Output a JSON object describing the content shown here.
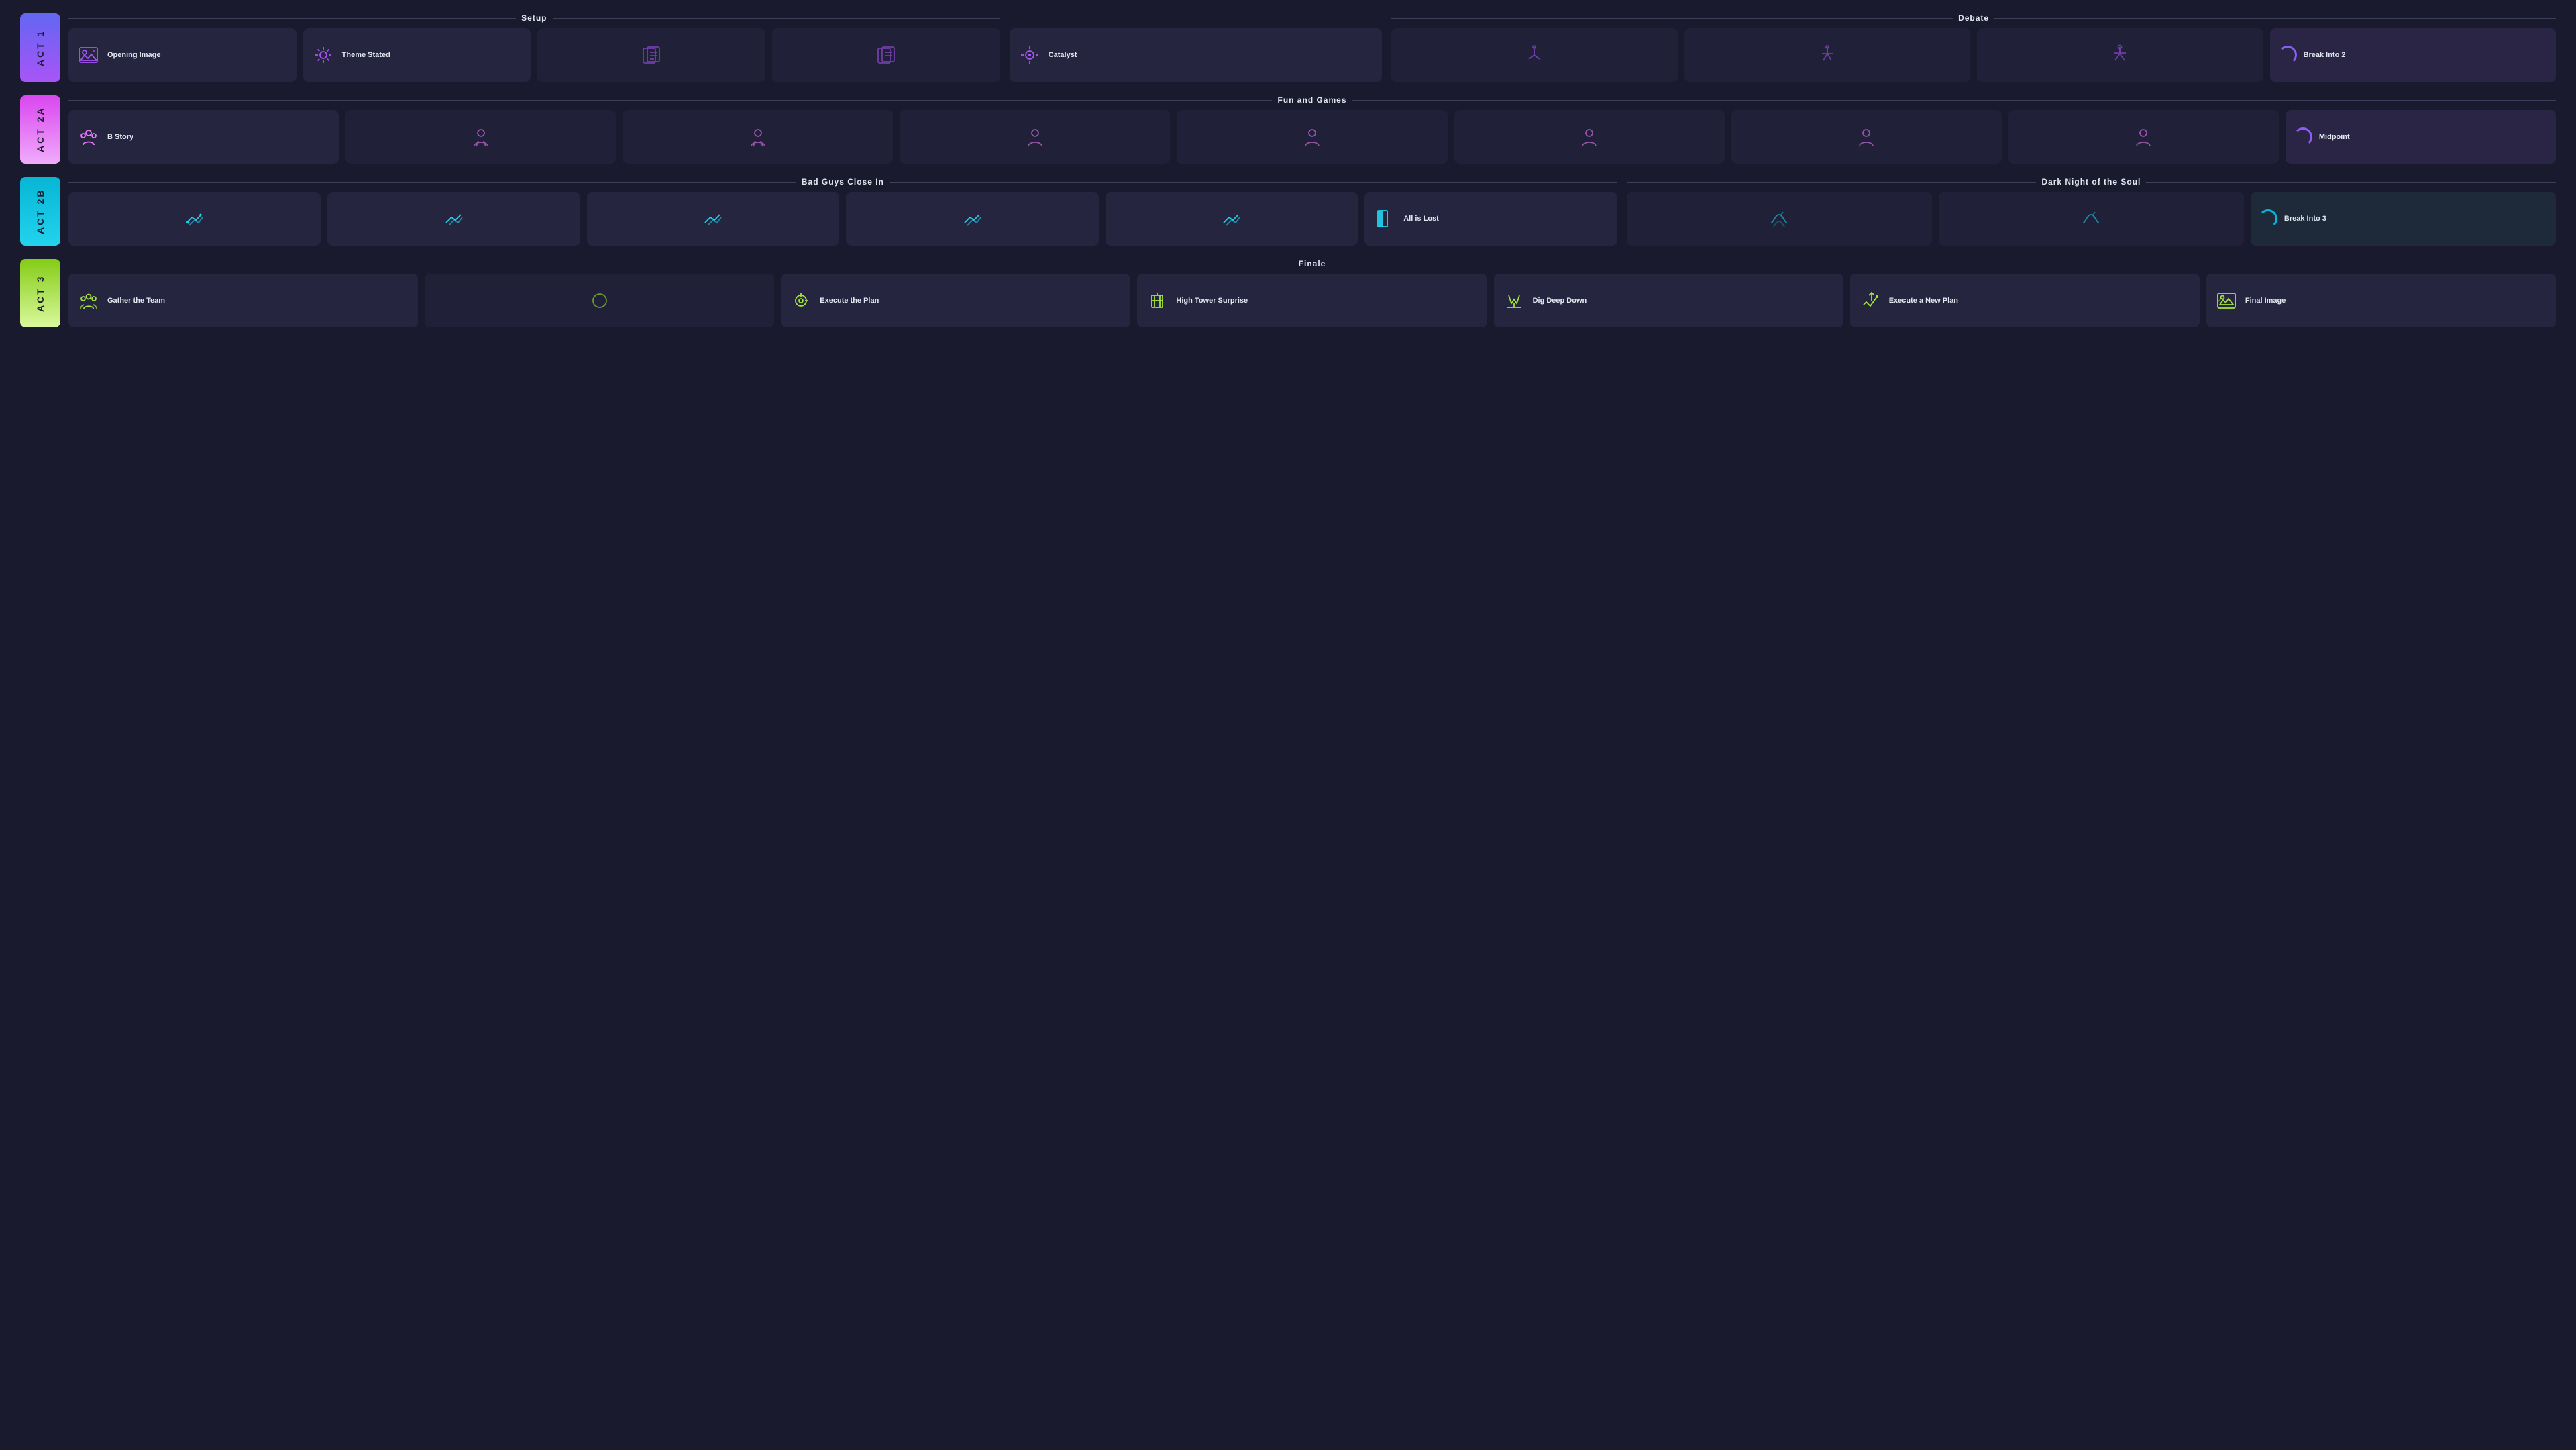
{
  "acts": {
    "act1": {
      "label": "ACT 1"
    },
    "act2a": {
      "label": "ACT 2A"
    },
    "act2b": {
      "label": "ACT 2B"
    },
    "act3": {
      "label": "ACT 3"
    }
  },
  "sections": {
    "setup": "Setup",
    "debate": "Debate",
    "funAndGames": "Fun and Games",
    "badGuysCloseIn": "Bad Guys Close In",
    "darkNightOfTheSoul": "Dark Night of the Soul",
    "finale": "Finale"
  },
  "beats": {
    "openingImage": "Opening Image",
    "themeStated": "Theme Stated",
    "catalyst": "Catalyst",
    "breakInto2": "Break Into 2",
    "bStory": "B Story",
    "midpoint": "Midpoint",
    "allIsLost": "All is Lost",
    "breakInto3": "Break Into 3",
    "gatherTheTeam": "Gather the Team",
    "executeThePlan": "Execute the Plan",
    "highTowerSurprise": "High Tower Surprise",
    "digDeepDown": "Dig Deep Down",
    "executeANewPlan": "Execute a New Plan",
    "finalImage": "Final Image"
  }
}
